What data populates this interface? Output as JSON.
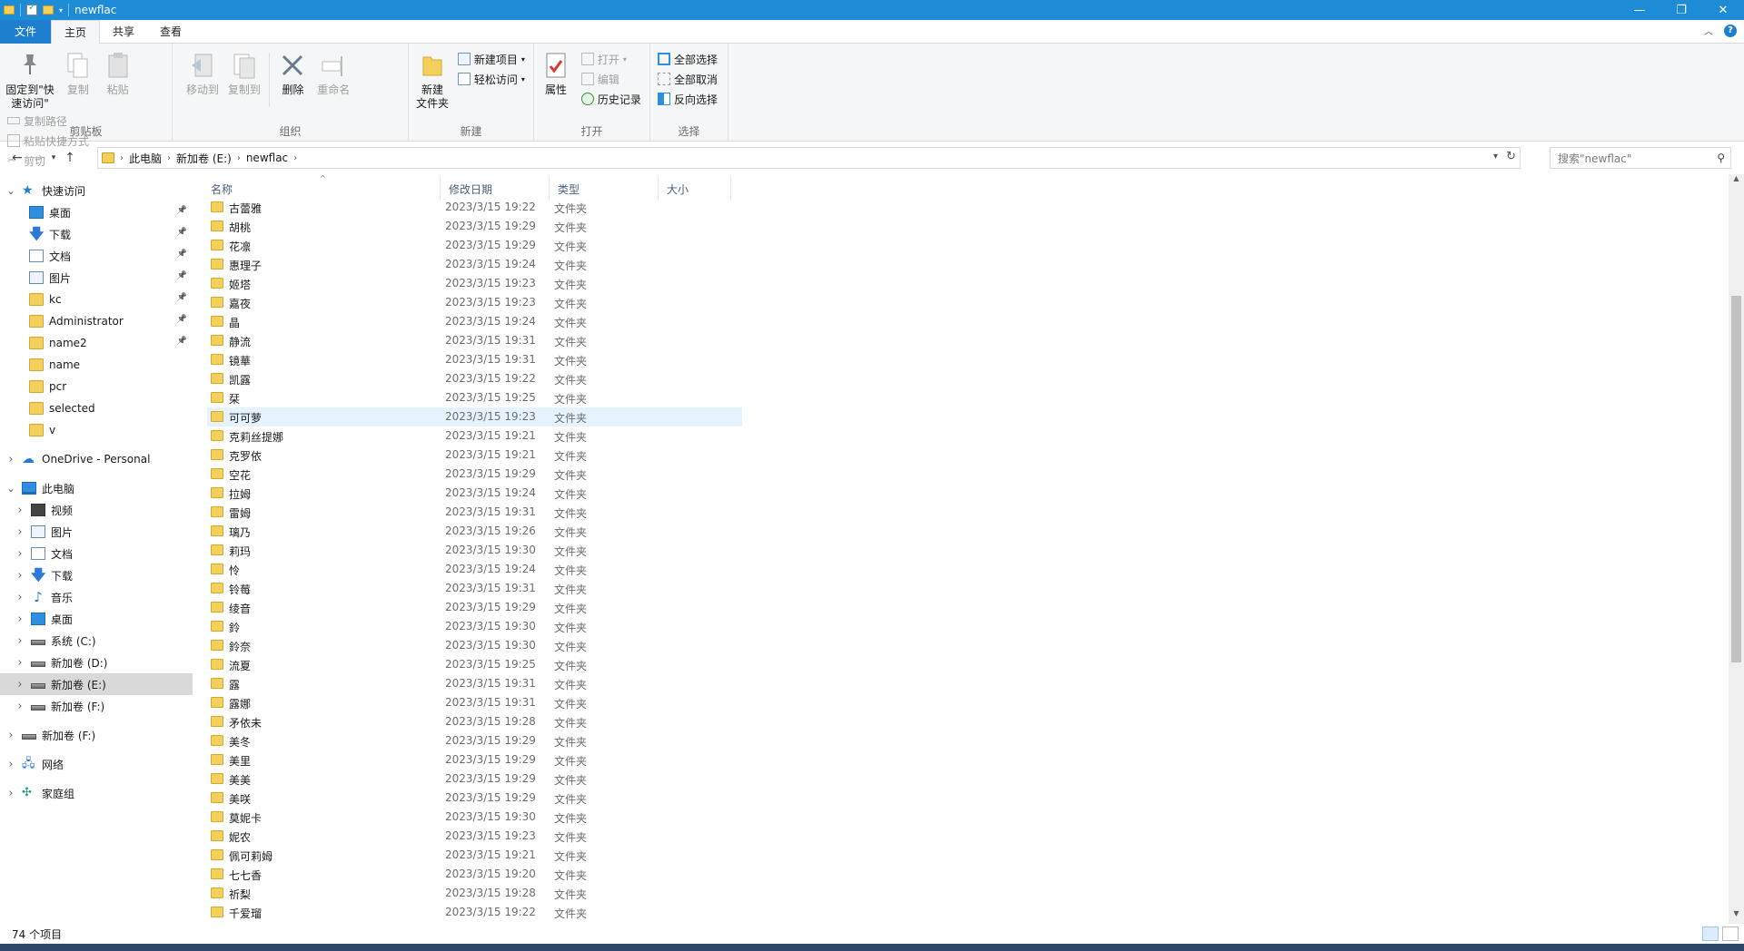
{
  "window": {
    "title": "newflac",
    "minimize": "—",
    "maximize": "❐",
    "close": "✕"
  },
  "tabs": [
    "文件",
    "主页",
    "共享",
    "查看"
  ],
  "ribbon": {
    "clipboard": {
      "label": "剪贴板",
      "pin": "固定到\"快速访问\"",
      "copy": "复制",
      "paste": "粘贴",
      "copy_path": "复制路径",
      "paste_shortcut": "粘贴快捷方式",
      "cut": "剪切"
    },
    "organize": {
      "label": "组织",
      "move_to": "移动到",
      "copy_to": "复制到",
      "delete": "删除",
      "rename": "重命名"
    },
    "new": {
      "label": "新建",
      "new_folder": "新建\n文件夹",
      "new_item": "新建项目",
      "easy_access": "轻松访问"
    },
    "open": {
      "label": "打开",
      "properties": "属性",
      "open": "打开",
      "edit": "编辑",
      "history": "历史记录"
    },
    "select": {
      "label": "选择",
      "select_all": "全部选择",
      "select_none": "全部取消",
      "invert": "反向选择"
    }
  },
  "address": {
    "crumbs": [
      "此电脑",
      "新加卷 (E:)",
      "newflac"
    ],
    "search_placeholder": "搜索\"newflac\""
  },
  "nav": {
    "quick_access": "快速访问",
    "quick_items": [
      {
        "label": "桌面",
        "icon": "desktop",
        "pinned": true
      },
      {
        "label": "下载",
        "icon": "download",
        "pinned": true
      },
      {
        "label": "文档",
        "icon": "document",
        "pinned": true
      },
      {
        "label": "图片",
        "icon": "pictures",
        "pinned": true
      },
      {
        "label": "kc",
        "icon": "folder",
        "pinned": true
      },
      {
        "label": "Administrator",
        "icon": "folder",
        "pinned": true
      },
      {
        "label": "name2",
        "icon": "folder",
        "pinned": true
      },
      {
        "label": "name",
        "icon": "folder",
        "pinned": false
      },
      {
        "label": "pcr",
        "icon": "folder",
        "pinned": false
      },
      {
        "label": "selected",
        "icon": "folder",
        "pinned": false
      },
      {
        "label": "v",
        "icon": "folder",
        "pinned": false
      }
    ],
    "onedrive": "OneDrive - Personal",
    "this_pc": "此电脑",
    "pc_items": [
      {
        "label": "视频",
        "icon": "video"
      },
      {
        "label": "图片",
        "icon": "pictures"
      },
      {
        "label": "文档",
        "icon": "document"
      },
      {
        "label": "下载",
        "icon": "download"
      },
      {
        "label": "音乐",
        "icon": "music"
      },
      {
        "label": "桌面",
        "icon": "desktop"
      },
      {
        "label": "系统 (C:)",
        "icon": "drive"
      },
      {
        "label": "新加卷 (D:)",
        "icon": "drive"
      },
      {
        "label": "新加卷 (E:)",
        "icon": "drive"
      },
      {
        "label": "新加卷 (F:)",
        "icon": "drive"
      }
    ],
    "drive_f": "新加卷 (F:)",
    "network": "网络",
    "homegroup": "家庭组"
  },
  "columns": {
    "name": "名称",
    "date": "修改日期",
    "type": "类型",
    "size": "大小"
  },
  "files": [
    {
      "name": "古蕾雅",
      "date": "2023/3/15 19:22",
      "type": "文件夹"
    },
    {
      "name": "胡桃",
      "date": "2023/3/15 19:29",
      "type": "文件夹"
    },
    {
      "name": "花凛",
      "date": "2023/3/15 19:29",
      "type": "文件夹"
    },
    {
      "name": "惠理子",
      "date": "2023/3/15 19:24",
      "type": "文件夹"
    },
    {
      "name": "姬塔",
      "date": "2023/3/15 19:23",
      "type": "文件夹"
    },
    {
      "name": "嘉夜",
      "date": "2023/3/15 19:23",
      "type": "文件夹"
    },
    {
      "name": "晶",
      "date": "2023/3/15 19:24",
      "type": "文件夹"
    },
    {
      "name": "静流",
      "date": "2023/3/15 19:31",
      "type": "文件夹"
    },
    {
      "name": "镜華",
      "date": "2023/3/15 19:31",
      "type": "文件夹"
    },
    {
      "name": "凯露",
      "date": "2023/3/15 19:22",
      "type": "文件夹"
    },
    {
      "name": "栞",
      "date": "2023/3/15 19:25",
      "type": "文件夹"
    },
    {
      "name": "可可萝",
      "date": "2023/3/15 19:23",
      "type": "文件夹"
    },
    {
      "name": "克莉丝提娜",
      "date": "2023/3/15 19:21",
      "type": "文件夹"
    },
    {
      "name": "克罗依",
      "date": "2023/3/15 19:21",
      "type": "文件夹"
    },
    {
      "name": "空花",
      "date": "2023/3/15 19:29",
      "type": "文件夹"
    },
    {
      "name": "拉姆",
      "date": "2023/3/15 19:24",
      "type": "文件夹"
    },
    {
      "name": "雷姆",
      "date": "2023/3/15 19:31",
      "type": "文件夹"
    },
    {
      "name": "璃乃",
      "date": "2023/3/15 19:26",
      "type": "文件夹"
    },
    {
      "name": "莉玛",
      "date": "2023/3/15 19:30",
      "type": "文件夹"
    },
    {
      "name": "怜",
      "date": "2023/3/15 19:24",
      "type": "文件夹"
    },
    {
      "name": "铃莓",
      "date": "2023/3/15 19:31",
      "type": "文件夹"
    },
    {
      "name": "绫音",
      "date": "2023/3/15 19:29",
      "type": "文件夹"
    },
    {
      "name": "鈴",
      "date": "2023/3/15 19:30",
      "type": "文件夹"
    },
    {
      "name": "鈴奈",
      "date": "2023/3/15 19:30",
      "type": "文件夹"
    },
    {
      "name": "流夏",
      "date": "2023/3/15 19:25",
      "type": "文件夹"
    },
    {
      "name": "露",
      "date": "2023/3/15 19:31",
      "type": "文件夹"
    },
    {
      "name": "露娜",
      "date": "2023/3/15 19:31",
      "type": "文件夹"
    },
    {
      "name": "矛依未",
      "date": "2023/3/15 19:28",
      "type": "文件夹"
    },
    {
      "name": "美冬",
      "date": "2023/3/15 19:29",
      "type": "文件夹"
    },
    {
      "name": "美里",
      "date": "2023/3/15 19:29",
      "type": "文件夹"
    },
    {
      "name": "美美",
      "date": "2023/3/15 19:29",
      "type": "文件夹"
    },
    {
      "name": "美咲",
      "date": "2023/3/15 19:29",
      "type": "文件夹"
    },
    {
      "name": "莫妮卡",
      "date": "2023/3/15 19:30",
      "type": "文件夹"
    },
    {
      "name": "妮农",
      "date": "2023/3/15 19:23",
      "type": "文件夹"
    },
    {
      "name": "佩可莉姆",
      "date": "2023/3/15 19:21",
      "type": "文件夹"
    },
    {
      "name": "七七香",
      "date": "2023/3/15 19:20",
      "type": "文件夹"
    },
    {
      "name": "祈梨",
      "date": "2023/3/15 19:28",
      "type": "文件夹"
    },
    {
      "name": "千爱瑠",
      "date": "2023/3/15 19:22",
      "type": "文件夹"
    }
  ],
  "hovered_row": "可可萝",
  "status": {
    "count": "74 个项目"
  },
  "colors": {
    "titlebar": "#1e8bd6",
    "file_tab": "#1e7fd1",
    "hover": "#e5f3ff",
    "folder": "#f3cf5b"
  }
}
